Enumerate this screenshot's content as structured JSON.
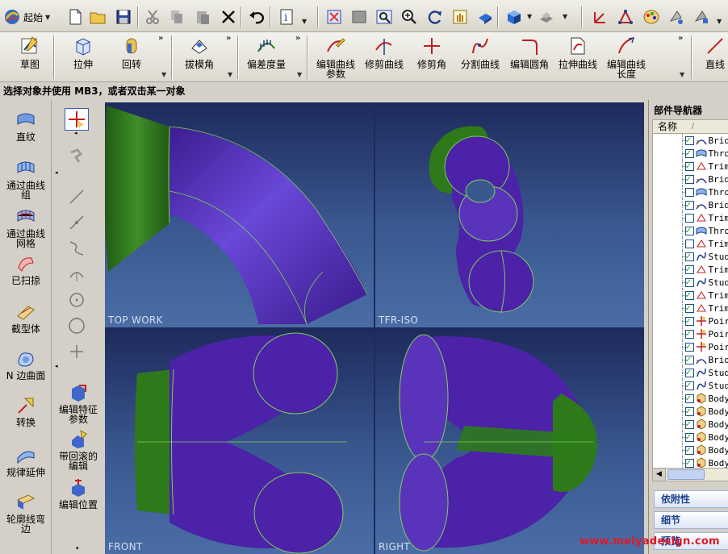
{
  "toolbar": {
    "start_label": "起始",
    "icons": [
      "new-file-icon",
      "open-folder-icon",
      "save-icon",
      "cut-icon",
      "copy-icon",
      "paste-icon",
      "delete-icon",
      "undo-icon",
      "info-icon",
      "fit-view-icon",
      "shaded-view-icon",
      "zoom-region-icon",
      "zoom-icon",
      "rotate-icon",
      "pan-icon",
      "render-style-icon",
      "cube-view-icon",
      "layer-icon",
      "wcs-icon",
      "csys-icon",
      "palette-icon",
      "select-filter-icon",
      "transform-icon"
    ]
  },
  "ribbon": {
    "items": [
      {
        "label": "草图"
      },
      {
        "label": "拉伸"
      },
      {
        "label": "回转"
      },
      {
        "label": "拔模角"
      },
      {
        "label": "偏差度量"
      },
      {
        "label": "编辑曲线",
        "label2": "参数"
      },
      {
        "label": "修剪曲线"
      },
      {
        "label": "修剪角"
      },
      {
        "label": "分割曲线"
      },
      {
        "label": "编辑圆角"
      },
      {
        "label": "拉伸曲线"
      },
      {
        "label": "编辑曲线",
        "label2": "长度"
      },
      {
        "label": "直线"
      }
    ]
  },
  "status_bar": {
    "prompt": "选择对象并使用 MB3，或者双击某一对象"
  },
  "left_commands": [
    {
      "label": "直纹"
    },
    {
      "label": "通过曲线",
      "label2": "组"
    },
    {
      "label": "通过曲线",
      "label2": "网格"
    },
    {
      "label": "已扫掠"
    },
    {
      "label": "截型体"
    },
    {
      "label": "N 边曲面"
    },
    {
      "label": "转换"
    },
    {
      "label": "规律延伸"
    },
    {
      "label": "轮廓线弯",
      "label2": "边"
    }
  ],
  "mid_commands": [
    {
      "label": "编辑特征",
      "label2": "参数"
    },
    {
      "label": "带回滚的",
      "label2": "编辑"
    },
    {
      "label": "编辑位置"
    }
  ],
  "viewports": [
    {
      "label": "TOP WORK"
    },
    {
      "label": "TFR-ISO"
    },
    {
      "label": "FRONT"
    },
    {
      "label": "RIGHT"
    }
  ],
  "part_navigator": {
    "title": "部件导航器",
    "column_name": "名称",
    "rows": [
      {
        "name": "Brid",
        "checked": true,
        "icon": "bridge-icon"
      },
      {
        "name": "Thro",
        "checked": true,
        "icon": "through-curves-icon"
      },
      {
        "name": "Trim",
        "checked": true,
        "icon": "trim-icon"
      },
      {
        "name": "Brid",
        "checked": true,
        "icon": "bridge-icon"
      },
      {
        "name": "Thro",
        "checked": false,
        "icon": "through-curves-icon"
      },
      {
        "name": "Brid",
        "checked": true,
        "icon": "bridge-icon"
      },
      {
        "name": "Trim",
        "checked": false,
        "icon": "trim-icon"
      },
      {
        "name": "Thro",
        "checked": true,
        "icon": "through-curves-icon"
      },
      {
        "name": "Trim",
        "checked": false,
        "icon": "trim-icon"
      },
      {
        "name": "Stud",
        "checked": true,
        "icon": "studio-spline-icon"
      },
      {
        "name": "Trim",
        "checked": true,
        "icon": "trim-icon"
      },
      {
        "name": "Stud",
        "checked": true,
        "icon": "studio-spline-icon"
      },
      {
        "name": "Trim",
        "checked": true,
        "icon": "trim-icon"
      },
      {
        "name": "Trim",
        "checked": true,
        "icon": "trim-icon"
      },
      {
        "name": "Poir",
        "checked": true,
        "icon": "point-icon"
      },
      {
        "name": "Poir",
        "checked": true,
        "icon": "point-icon"
      },
      {
        "name": "Poir",
        "checked": true,
        "icon": "point-icon"
      },
      {
        "name": "Brid",
        "checked": true,
        "icon": "bridge-icon"
      },
      {
        "name": "Stud",
        "checked": true,
        "icon": "studio-spline-icon"
      },
      {
        "name": "Stud",
        "checked": true,
        "icon": "studio-spline-icon"
      },
      {
        "name": "Body",
        "checked": true,
        "icon": "body-icon"
      },
      {
        "name": "Body",
        "checked": true,
        "icon": "body-icon"
      },
      {
        "name": "Body",
        "checked": true,
        "icon": "body-icon"
      },
      {
        "name": "Body",
        "checked": true,
        "icon": "body-icon"
      },
      {
        "name": "Body",
        "checked": true,
        "icon": "body-icon"
      },
      {
        "name": "Body",
        "checked": true,
        "icon": "body-icon"
      }
    ],
    "panels": [
      {
        "label": "依附性"
      },
      {
        "label": "细节"
      },
      {
        "label": "预览"
      }
    ]
  },
  "watermark": "www.meiyadesign.com",
  "colors": {
    "surface_purple": "#4b22a8",
    "surface_green": "#2e7a1a",
    "viewport_top": "#1e2a5c",
    "viewport_bottom": "#4a6da5",
    "watermark_red": "#e0182a"
  }
}
